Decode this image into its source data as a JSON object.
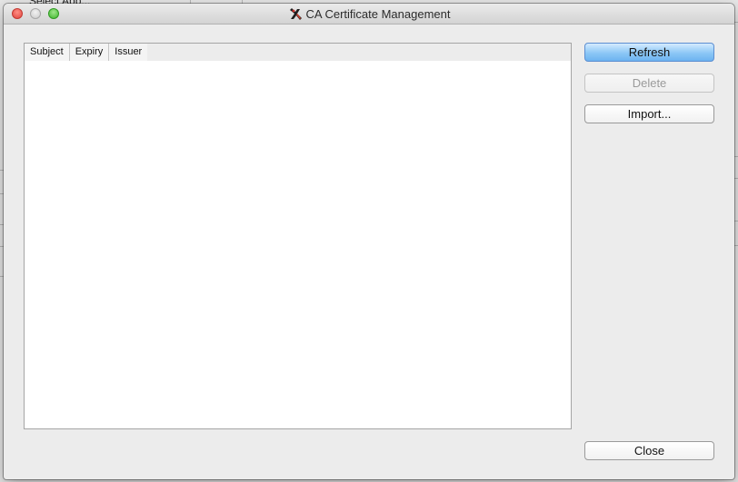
{
  "background_app": {
    "top_label": "Select App..."
  },
  "window": {
    "title": "CA Certificate Management"
  },
  "table": {
    "columns": [
      "Subject",
      "Expiry",
      "Issuer"
    ]
  },
  "buttons": {
    "refresh": "Refresh",
    "delete": "Delete",
    "import": "Import...",
    "close": "Close"
  },
  "colors": {
    "default_button": "#8cc7f6",
    "window_background": "#ececec",
    "table_background": "#ffffff"
  },
  "icons": {
    "title": "app-logo-icon"
  }
}
